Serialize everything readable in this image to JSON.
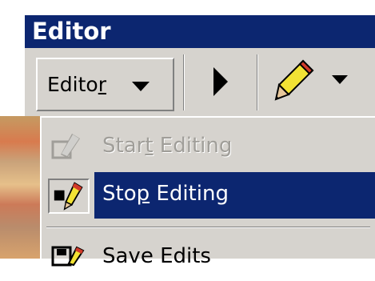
{
  "window": {
    "title": "Editor"
  },
  "toolbar": {
    "editor_menu": {
      "label_prefix": "Edito",
      "label_mnemonic": "r",
      "arrow_icon": "dropdown-triangle-icon"
    },
    "tools": [
      {
        "name": "edit-tool-arrow",
        "icon": "pointer-arrow-icon"
      },
      {
        "name": "sketch-tool",
        "icon": "pencil-icon"
      }
    ]
  },
  "menu": {
    "items": [
      {
        "label_prefix": "Star",
        "label_mnemonic": "t",
        "label_suffix": " Editing",
        "state": "disabled",
        "icon": "start-editing-icon"
      },
      {
        "label_prefix": "Sto",
        "label_mnemonic": "p",
        "label_suffix": " Editing",
        "state": "selected",
        "icon": "stop-editing-icon"
      },
      {
        "label_prefix": "",
        "label_mnemonic": "",
        "label_suffix": "Save Edits",
        "state": "normal",
        "icon": "save-edits-icon"
      }
    ]
  },
  "colors": {
    "titlebar": "#0c2670",
    "menu_bg": "#d6d3ce",
    "highlight": "#0c2670",
    "disabled_text": "#a09e99"
  }
}
